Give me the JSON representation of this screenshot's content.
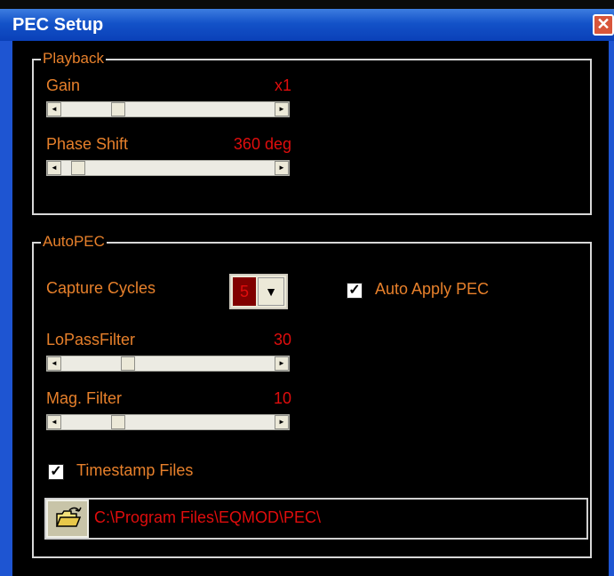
{
  "window": {
    "title": "PEC Setup",
    "close_label": "✕"
  },
  "playback": {
    "legend": "Playback",
    "gain": {
      "label": "Gain",
      "value": "x1",
      "level": 0.25
    },
    "phase_shift": {
      "label": "Phase Shift",
      "value": "360 deg",
      "level": 0.05
    }
  },
  "autopec": {
    "legend": "AutoPEC",
    "capture_cycles": {
      "label": "Capture Cycles",
      "value": "5"
    },
    "auto_apply": {
      "label": "Auto Apply PEC",
      "checked": true
    },
    "lopass": {
      "label": "LoPassFilter",
      "value": "30",
      "level": 0.3
    },
    "mag_filter": {
      "label": "Mag. Filter",
      "value": "10",
      "level": 0.25
    },
    "timestamp": {
      "label": "Timestamp Files",
      "checked": true
    },
    "path": "C:\\Program Files\\EQMOD\\PEC\\"
  },
  "colors": {
    "label": "#e7802b",
    "value": "#e00d0d",
    "titlebar": "#1352c8"
  },
  "icons": {
    "close": "close-icon",
    "folder": "folder-open-icon",
    "check": "checkmark-icon"
  }
}
